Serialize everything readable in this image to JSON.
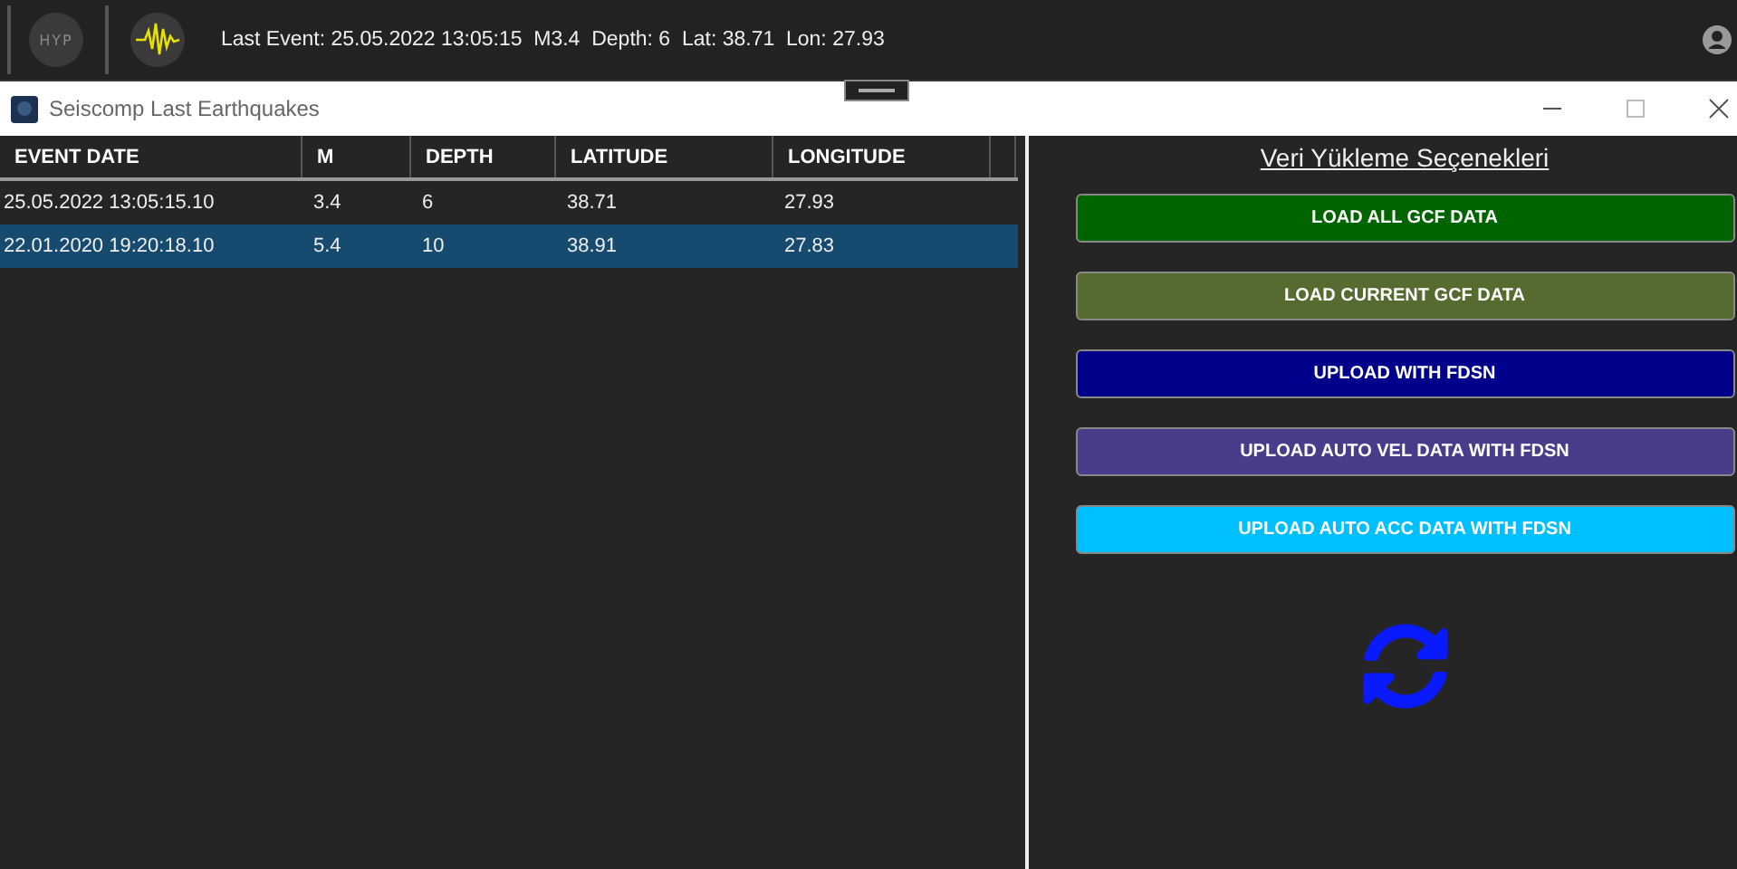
{
  "top_bar": {
    "logo": "HYP",
    "last_event": "Last Event: 25.05.2022 13:05:15  M3.4  Depth: 6  Lat: 38.71  Lon: 27.93"
  },
  "window": {
    "title": "Seiscomp Last Earthquakes"
  },
  "table": {
    "columns": [
      "EVENT DATE",
      "M",
      "DEPTH",
      "LATITUDE",
      "LONGITUDE"
    ],
    "rows": [
      {
        "cells": [
          "25.05.2022 13:05:15.10",
          "3.4",
          "6",
          "38.71",
          "27.93"
        ],
        "selected": false
      },
      {
        "cells": [
          "22.01.2020 19:20:18.10",
          "5.4",
          "10",
          "38.91",
          "27.83"
        ],
        "selected": true
      }
    ]
  },
  "options": {
    "title": "Veri Yükleme Seçenekleri",
    "buttons": [
      {
        "label": "LOAD ALL GCF DATA",
        "color": "#006400"
      },
      {
        "label": "LOAD CURRENT GCF DATA",
        "color": "#556b2f"
      },
      {
        "label": "UPLOAD WITH FDSN",
        "color": "#00008b"
      },
      {
        "label": "UPLOAD AUTO VEL DATA WITH FDSN",
        "color": "#483d8b"
      },
      {
        "label": "UPLOAD AUTO ACC DATA WITH FDSN",
        "color": "#00bfff"
      }
    ]
  }
}
